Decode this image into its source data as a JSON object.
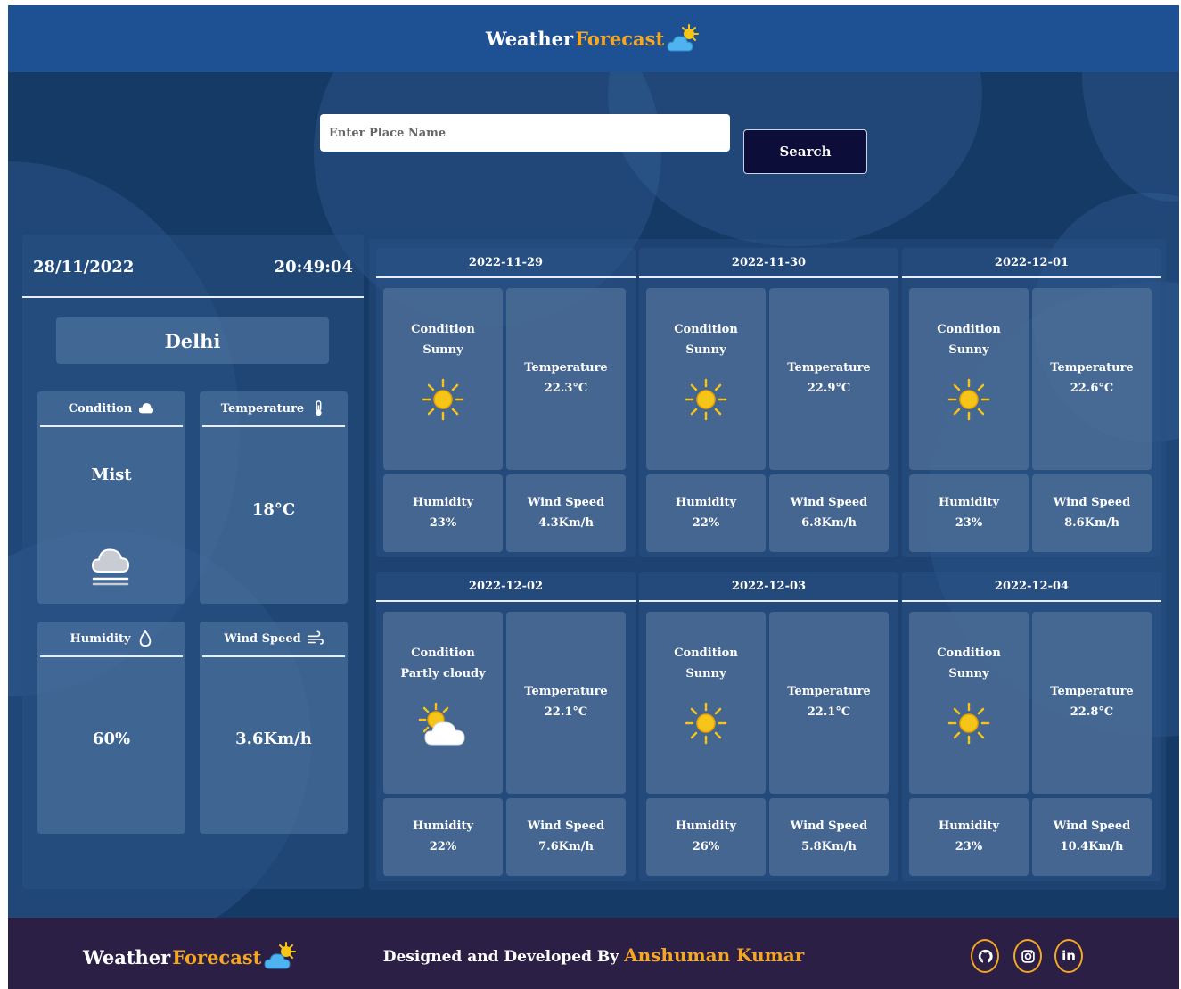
{
  "header": {
    "brand_main": "Weather",
    "brand_accent": "Forecast"
  },
  "search": {
    "placeholder": "Enter Place Name",
    "value": "",
    "button_label": "Search"
  },
  "current": {
    "date": "28/11/2022",
    "time": "20:49:04",
    "city": "Delhi",
    "condition": {
      "label": "Condition",
      "value": "Mist",
      "icon": "cloud-icon",
      "value_icon": "mist-cloud-icon"
    },
    "temperature": {
      "label": "Temperature",
      "value": "18°C",
      "icon": "thermometer-icon"
    },
    "humidity": {
      "label": "Humidity",
      "value": "60%",
      "icon": "droplet-icon"
    },
    "wind": {
      "label": "Wind Speed",
      "value": "3.6Km/h",
      "icon": "wind-icon"
    }
  },
  "labels": {
    "condition": "Condition",
    "temperature": "Temperature",
    "humidity": "Humidity",
    "wind": "Wind Speed"
  },
  "forecast": [
    {
      "date": "2022-11-29",
      "condition": "Sunny",
      "icon": "sun-icon",
      "temperature": "22.3°C",
      "humidity": "23%",
      "wind": "4.3Km/h"
    },
    {
      "date": "2022-11-30",
      "condition": "Sunny",
      "icon": "sun-icon",
      "temperature": "22.9°C",
      "humidity": "22%",
      "wind": "6.8Km/h"
    },
    {
      "date": "2022-12-01",
      "condition": "Sunny",
      "icon": "sun-icon",
      "temperature": "22.6°C",
      "humidity": "23%",
      "wind": "8.6Km/h"
    },
    {
      "date": "2022-12-02",
      "condition": "Partly cloudy",
      "icon": "partly-cloudy-icon",
      "temperature": "22.1°C",
      "humidity": "22%",
      "wind": "7.6Km/h"
    },
    {
      "date": "2022-12-03",
      "condition": "Sunny",
      "icon": "sun-icon",
      "temperature": "22.1°C",
      "humidity": "26%",
      "wind": "5.8Km/h"
    },
    {
      "date": "2022-12-04",
      "condition": "Sunny",
      "icon": "sun-icon",
      "temperature": "22.8°C",
      "humidity": "23%",
      "wind": "10.4Km/h"
    }
  ],
  "footer": {
    "brand_main": "Weather",
    "brand_accent": "Forecast",
    "credit_prefix": "Designed and Developed By ",
    "author": "Anshuman Kumar",
    "social": [
      {
        "icon": "github-icon"
      },
      {
        "icon": "instagram-icon"
      },
      {
        "icon": "linkedin-icon",
        "text": "in"
      }
    ]
  },
  "colors": {
    "accent": "#f5a623",
    "header": "#1d5193",
    "footer": "#2b1f45",
    "background": "#163a66",
    "button": "#0d0d3a"
  }
}
